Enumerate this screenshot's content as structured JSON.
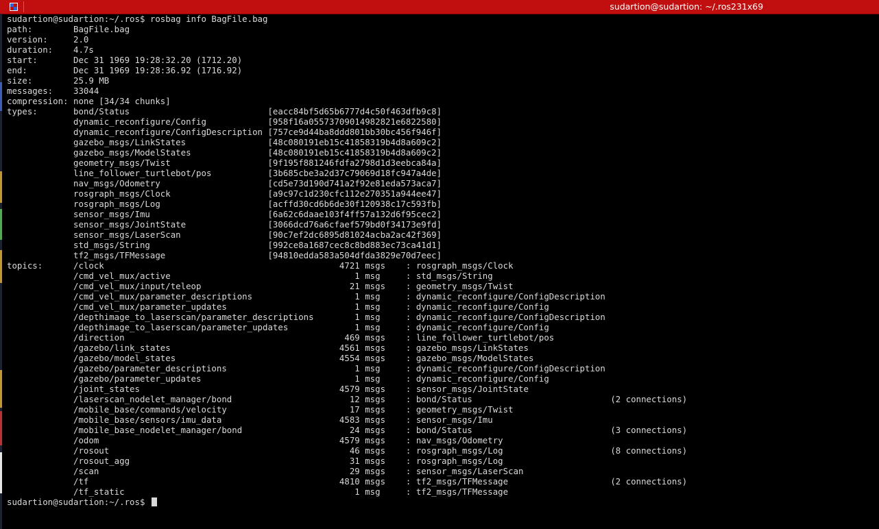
{
  "window": {
    "title": "sudartion@sudartion: ~/.ros",
    "size_text": "231x69",
    "titlebar_color": "#c10f0f",
    "icon": "terminal-window-icon"
  },
  "terminal": {
    "bg_color": "#000000",
    "fg_color": "#d9d9d9",
    "prompt": "sudartion@sudartion:~/.ros$",
    "command": "rosbag info BagFile.bag",
    "info": [
      {
        "key": "path:",
        "value": "BagFile.bag"
      },
      {
        "key": "version:",
        "value": "2.0"
      },
      {
        "key": "duration:",
        "value": "4.7s"
      },
      {
        "key": "start:",
        "value": "Dec 31 1969 19:28:32.20 (1712.20)"
      },
      {
        "key": "end:",
        "value": "Dec 31 1969 19:28:36.92 (1716.92)"
      },
      {
        "key": "size:",
        "value": "25.9 MB"
      },
      {
        "key": "messages:",
        "value": "33044"
      },
      {
        "key": "compression:",
        "value": "none [34/34 chunks]"
      }
    ],
    "types_label": "types:",
    "types": [
      {
        "name": "bond/Status",
        "md5": "[eacc84bf5d65b6777d4c50f463dfb9c8]"
      },
      {
        "name": "dynamic_reconfigure/Config",
        "md5": "[958f16a05573709014982821e6822580]"
      },
      {
        "name": "dynamic_reconfigure/ConfigDescription",
        "md5": "[757ce9d44ba8ddd801bb30bc456f946f]"
      },
      {
        "name": "gazebo_msgs/LinkStates",
        "md5": "[48c080191eb15c41858319b4d8a609c2]"
      },
      {
        "name": "gazebo_msgs/ModelStates",
        "md5": "[48c080191eb15c41858319b4d8a609c2]"
      },
      {
        "name": "geometry_msgs/Twist",
        "md5": "[9f195f881246fdfa2798d1d3eebca84a]"
      },
      {
        "name": "line_follower_turtlebot/pos",
        "md5": "[3b685cbe3a2d37c79069d18fc947a4de]"
      },
      {
        "name": "nav_msgs/Odometry",
        "md5": "[cd5e73d190d741a2f92e81eda573aca7]"
      },
      {
        "name": "rosgraph_msgs/Clock",
        "md5": "[a9c97c1d230cfc112e270351a944ee47]"
      },
      {
        "name": "rosgraph_msgs/Log",
        "md5": "[acffd30cd6b6de30f120938c17c593fb]"
      },
      {
        "name": "sensor_msgs/Imu",
        "md5": "[6a62c6daae103f4ff57a132d6f95cec2]"
      },
      {
        "name": "sensor_msgs/JointState",
        "md5": "[3066dcd76a6cfaef579bd0f34173e9fd]"
      },
      {
        "name": "sensor_msgs/LaserScan",
        "md5": "[90c7ef2dc6895d81024acba2ac42f369]"
      },
      {
        "name": "std_msgs/String",
        "md5": "[992ce8a1687cec8c8bd883ec73ca41d1]"
      },
      {
        "name": "tf2_msgs/TFMessage",
        "md5": "[94810edda583a504dfda3829e70d7eec]"
      }
    ],
    "topics_label": "topics:",
    "topics": [
      {
        "topic": "/clock",
        "count": "4721",
        "unit": "msgs",
        "type": "rosgraph_msgs/Clock",
        "conn": ""
      },
      {
        "topic": "/cmd_vel_mux/active",
        "count": "1",
        "unit": "msg",
        "type": "std_msgs/String",
        "conn": ""
      },
      {
        "topic": "/cmd_vel_mux/input/teleop",
        "count": "21",
        "unit": "msgs",
        "type": "geometry_msgs/Twist",
        "conn": ""
      },
      {
        "topic": "/cmd_vel_mux/parameter_descriptions",
        "count": "1",
        "unit": "msg",
        "type": "dynamic_reconfigure/ConfigDescription",
        "conn": ""
      },
      {
        "topic": "/cmd_vel_mux/parameter_updates",
        "count": "1",
        "unit": "msg",
        "type": "dynamic_reconfigure/Config",
        "conn": ""
      },
      {
        "topic": "/depthimage_to_laserscan/parameter_descriptions",
        "count": "1",
        "unit": "msg",
        "type": "dynamic_reconfigure/ConfigDescription",
        "conn": ""
      },
      {
        "topic": "/depthimage_to_laserscan/parameter_updates",
        "count": "1",
        "unit": "msg",
        "type": "dynamic_reconfigure/Config",
        "conn": ""
      },
      {
        "topic": "/direction",
        "count": "469",
        "unit": "msgs",
        "type": "line_follower_turtlebot/pos",
        "conn": ""
      },
      {
        "topic": "/gazebo/link_states",
        "count": "4561",
        "unit": "msgs",
        "type": "gazebo_msgs/LinkStates",
        "conn": ""
      },
      {
        "topic": "/gazebo/model_states",
        "count": "4554",
        "unit": "msgs",
        "type": "gazebo_msgs/ModelStates",
        "conn": ""
      },
      {
        "topic": "/gazebo/parameter_descriptions",
        "count": "1",
        "unit": "msg",
        "type": "dynamic_reconfigure/ConfigDescription",
        "conn": ""
      },
      {
        "topic": "/gazebo/parameter_updates",
        "count": "1",
        "unit": "msg",
        "type": "dynamic_reconfigure/Config",
        "conn": ""
      },
      {
        "topic": "/joint_states",
        "count": "4579",
        "unit": "msgs",
        "type": "sensor_msgs/JointState",
        "conn": ""
      },
      {
        "topic": "/laserscan_nodelet_manager/bond",
        "count": "12",
        "unit": "msgs",
        "type": "bond/Status",
        "conn": "(2 connections)"
      },
      {
        "topic": "/mobile_base/commands/velocity",
        "count": "17",
        "unit": "msgs",
        "type": "geometry_msgs/Twist",
        "conn": ""
      },
      {
        "topic": "/mobile_base/sensors/imu_data",
        "count": "4583",
        "unit": "msgs",
        "type": "sensor_msgs/Imu",
        "conn": ""
      },
      {
        "topic": "/mobile_base_nodelet_manager/bond",
        "count": "24",
        "unit": "msgs",
        "type": "bond/Status",
        "conn": "(3 connections)"
      },
      {
        "topic": "/odom",
        "count": "4579",
        "unit": "msgs",
        "type": "nav_msgs/Odometry",
        "conn": ""
      },
      {
        "topic": "/rosout",
        "count": "46",
        "unit": "msgs",
        "type": "rosgraph_msgs/Log",
        "conn": "(8 connections)"
      },
      {
        "topic": "/rosout_agg",
        "count": "31",
        "unit": "msgs",
        "type": "rosgraph_msgs/Log",
        "conn": ""
      },
      {
        "topic": "/scan",
        "count": "29",
        "unit": "msgs",
        "type": "sensor_msgs/LaserScan",
        "conn": ""
      },
      {
        "topic": "/tf",
        "count": "4810",
        "unit": "msgs",
        "type": "tf2_msgs/TFMessage",
        "conn": "(2 connections)"
      },
      {
        "topic": "/tf_static",
        "count": "1",
        "unit": "msg",
        "type": "tf2_msgs/TFMessage",
        "conn": ""
      }
    ]
  }
}
